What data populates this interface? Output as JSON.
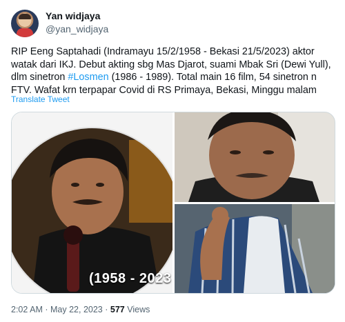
{
  "author": {
    "name": "Yan widjaya",
    "handle": "@yan_widjaya"
  },
  "tweet": {
    "text_before_hashtag": "RIP Eeng Saptahadi (Indramayu 15/2/1958 - Bekasi 21/5/2023) aktor watak dari IKJ. Debut akting sbg Mas Djarot, suami Mbak Sri (Dewi Yull), dlm sinetron ",
    "hashtag": "#Losmen",
    "text_after_hashtag": " (1986 - 1989). Total main 16 film, 54 sinetron n FTV. Wafat krn terpapar Covid di RS Primaya, Bekasi, Minggu malam",
    "translate_label": "Translate Tweet"
  },
  "media": {
    "year_label": "(1958 - 2023"
  },
  "meta": {
    "time": "2:02 AM",
    "separator": "·",
    "date": "May 22, 2023",
    "views_count": "577",
    "views_label": "Views"
  },
  "colors": {
    "link": "#1d9bf0",
    "secondary_text": "#536471",
    "border": "#cfd9de"
  }
}
